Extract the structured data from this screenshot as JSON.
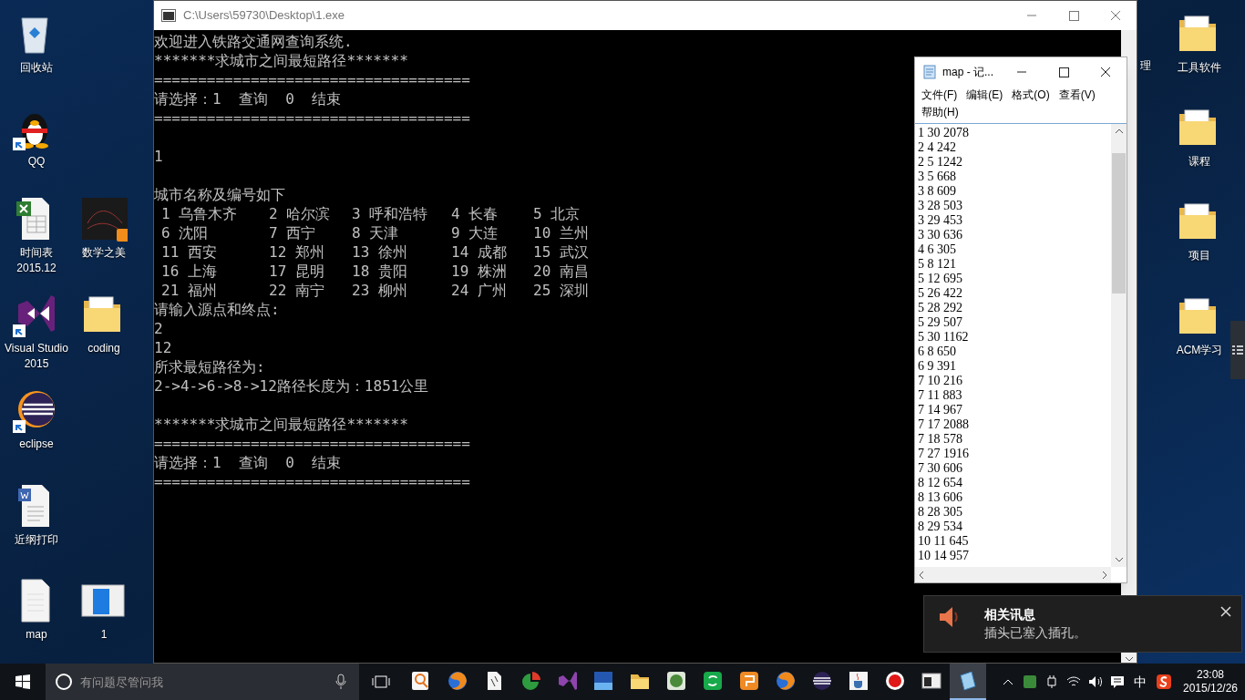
{
  "desktop": {
    "left_column": [
      {
        "label": "回收站",
        "kind": "bin",
        "shortcut": false
      },
      {
        "label": "QQ",
        "kind": "penguin",
        "shortcut": true
      },
      {
        "label": "时间表 2015.12",
        "kind": "sheet",
        "shortcut": false
      },
      {
        "label": "Visual Studio 2015",
        "kind": "vs",
        "shortcut": true
      },
      {
        "label": "eclipse",
        "kind": "eclipse",
        "shortcut": true
      },
      {
        "label": "近纲打印",
        "kind": "word",
        "shortcut": false
      },
      {
        "label": "map",
        "kind": "text",
        "shortcut": false
      }
    ],
    "second_column": [
      {
        "label": "数学之美",
        "kind": "book",
        "shortcut": false
      },
      {
        "label": "coding",
        "kind": "folder",
        "shortcut": false
      },
      {
        "label": "1",
        "kind": "thumb",
        "shortcut": false
      }
    ],
    "right_column": [
      {
        "label": "工具软件",
        "kind": "folder",
        "shortcut": false
      },
      {
        "label": "课程",
        "kind": "folder",
        "shortcut": false
      },
      {
        "label": "项目",
        "kind": "folder",
        "shortcut": false
      },
      {
        "label": "ACM学习",
        "kind": "folder",
        "shortcut": false
      }
    ],
    "cut_label": "理"
  },
  "console": {
    "title": "C:\\Users\\59730\\Desktop\\1.exe",
    "lines": [
      {
        "kind": "text",
        "text": "欢迎进入铁路交通网查询系统."
      },
      {
        "kind": "text",
        "text": "*******求城市之间最短路径*******"
      },
      {
        "kind": "text",
        "text": "===================================="
      },
      {
        "kind": "text",
        "text": "请选择：1  查询  0  结束"
      },
      {
        "kind": "text",
        "text": "===================================="
      },
      {
        "kind": "blank"
      },
      {
        "kind": "text",
        "text": "1"
      },
      {
        "kind": "blank"
      },
      {
        "kind": "text",
        "text": "城市名称及编号如下"
      },
      {
        "kind": "table",
        "rows": [
          [
            "1 乌鲁木齐",
            "2 哈尔滨",
            "3 呼和浩特",
            "4 长春",
            "5 北京"
          ],
          [
            "6 沈阳",
            "7 西宁",
            "8 天津",
            "9 大连",
            "10 兰州"
          ],
          [
            "11 西安",
            "12 郑州",
            "13 徐州",
            "14 成都",
            "15 武汉"
          ],
          [
            "16 上海",
            "17 昆明",
            "18 贵阳",
            "19 株洲",
            "20 南昌"
          ],
          [
            "21 福州",
            "22 南宁",
            "23 柳州",
            "24 广州",
            "25 深圳"
          ]
        ]
      },
      {
        "kind": "text",
        "text": "请输入源点和终点:"
      },
      {
        "kind": "text",
        "text": "2"
      },
      {
        "kind": "text",
        "text": "12"
      },
      {
        "kind": "text",
        "text": "所求最短路径为:"
      },
      {
        "kind": "text",
        "text": "2->4->6->8->12路径长度为：1851公里"
      },
      {
        "kind": "blank"
      },
      {
        "kind": "text",
        "text": "*******求城市之间最短路径*******"
      },
      {
        "kind": "text",
        "text": "===================================="
      },
      {
        "kind": "text",
        "text": "请选择：1  查询  0  结束"
      },
      {
        "kind": "text",
        "text": "===================================="
      }
    ]
  },
  "notepad": {
    "title": "map - 记...",
    "menu": [
      "文件(F)",
      "编辑(E)",
      "格式(O)",
      "查看(V)",
      "帮助(H)"
    ],
    "lines": [
      "1 30 2078",
      "2 4 242",
      "2 5 1242",
      "3 5 668",
      "3 8 609",
      "3 28 503",
      "3 29 453",
      "3 30 636",
      "4 6 305",
      "5 8 121",
      "5 12 695",
      "5 26 422",
      "5 28 292",
      "5 29 507",
      "5 30 1162",
      "6 8 650",
      "6 9 391",
      "7 10 216",
      "7 11 883",
      "7 14 967",
      "7 17 2088",
      "7 18 578",
      "7 27 1916",
      "7 30 606",
      "8 12 654",
      "8 13 606",
      "8 28 305",
      "8 29 534",
      "10 11 645",
      "10 14 957"
    ]
  },
  "notification": {
    "title": "相关讯息",
    "body": "插头已塞入插孔。"
  },
  "taskbar": {
    "search_placeholder": "有问题尽管问我",
    "apps": [
      {
        "kind": "magnifier",
        "selected": false
      },
      {
        "kind": "globe",
        "selected": false
      },
      {
        "kind": "document",
        "selected": false
      },
      {
        "kind": "chart",
        "selected": false
      },
      {
        "kind": "vs",
        "selected": false
      },
      {
        "kind": "bluesquare",
        "selected": false
      },
      {
        "kind": "folder",
        "selected": false
      },
      {
        "kind": "greenring",
        "selected": false
      },
      {
        "kind": "greensquare",
        "selected": false
      },
      {
        "kind": "orangesquare",
        "selected": false
      },
      {
        "kind": "globe",
        "selected": false
      },
      {
        "kind": "eclipse",
        "selected": false
      },
      {
        "kind": "cup",
        "selected": false
      },
      {
        "kind": "record",
        "selected": false
      },
      {
        "kind": "window",
        "selected": false
      },
      {
        "kind": "notepad",
        "selected": true
      }
    ],
    "ime": "中",
    "time": "23:08",
    "date": "2015/12/26"
  }
}
